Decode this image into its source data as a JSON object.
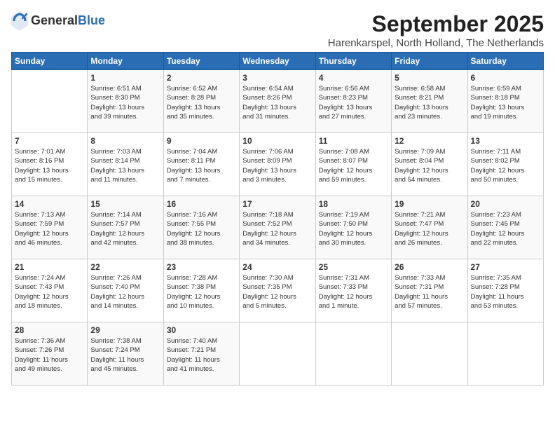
{
  "header": {
    "logo_general": "General",
    "logo_blue": "Blue",
    "month_title": "September 2025",
    "subtitle": "Harenkarspel, North Holland, The Netherlands"
  },
  "days_of_week": [
    "Sunday",
    "Monday",
    "Tuesday",
    "Wednesday",
    "Thursday",
    "Friday",
    "Saturday"
  ],
  "weeks": [
    [
      {
        "day": "",
        "info": ""
      },
      {
        "day": "1",
        "info": "Sunrise: 6:51 AM\nSunset: 8:30 PM\nDaylight: 13 hours\nand 39 minutes."
      },
      {
        "day": "2",
        "info": "Sunrise: 6:52 AM\nSunset: 8:28 PM\nDaylight: 13 hours\nand 35 minutes."
      },
      {
        "day": "3",
        "info": "Sunrise: 6:54 AM\nSunset: 8:26 PM\nDaylight: 13 hours\nand 31 minutes."
      },
      {
        "day": "4",
        "info": "Sunrise: 6:56 AM\nSunset: 8:23 PM\nDaylight: 13 hours\nand 27 minutes."
      },
      {
        "day": "5",
        "info": "Sunrise: 6:58 AM\nSunset: 8:21 PM\nDaylight: 13 hours\nand 23 minutes."
      },
      {
        "day": "6",
        "info": "Sunrise: 6:59 AM\nSunset: 8:18 PM\nDaylight: 13 hours\nand 19 minutes."
      }
    ],
    [
      {
        "day": "7",
        "info": "Sunrise: 7:01 AM\nSunset: 8:16 PM\nDaylight: 13 hours\nand 15 minutes."
      },
      {
        "day": "8",
        "info": "Sunrise: 7:03 AM\nSunset: 8:14 PM\nDaylight: 13 hours\nand 11 minutes."
      },
      {
        "day": "9",
        "info": "Sunrise: 7:04 AM\nSunset: 8:11 PM\nDaylight: 13 hours\nand 7 minutes."
      },
      {
        "day": "10",
        "info": "Sunrise: 7:06 AM\nSunset: 8:09 PM\nDaylight: 13 hours\nand 3 minutes."
      },
      {
        "day": "11",
        "info": "Sunrise: 7:08 AM\nSunset: 8:07 PM\nDaylight: 12 hours\nand 59 minutes."
      },
      {
        "day": "12",
        "info": "Sunrise: 7:09 AM\nSunset: 8:04 PM\nDaylight: 12 hours\nand 54 minutes."
      },
      {
        "day": "13",
        "info": "Sunrise: 7:11 AM\nSunset: 8:02 PM\nDaylight: 12 hours\nand 50 minutes."
      }
    ],
    [
      {
        "day": "14",
        "info": "Sunrise: 7:13 AM\nSunset: 7:59 PM\nDaylight: 12 hours\nand 46 minutes."
      },
      {
        "day": "15",
        "info": "Sunrise: 7:14 AM\nSunset: 7:57 PM\nDaylight: 12 hours\nand 42 minutes."
      },
      {
        "day": "16",
        "info": "Sunrise: 7:16 AM\nSunset: 7:55 PM\nDaylight: 12 hours\nand 38 minutes."
      },
      {
        "day": "17",
        "info": "Sunrise: 7:18 AM\nSunset: 7:52 PM\nDaylight: 12 hours\nand 34 minutes."
      },
      {
        "day": "18",
        "info": "Sunrise: 7:19 AM\nSunset: 7:50 PM\nDaylight: 12 hours\nand 30 minutes."
      },
      {
        "day": "19",
        "info": "Sunrise: 7:21 AM\nSunset: 7:47 PM\nDaylight: 12 hours\nand 26 minutes."
      },
      {
        "day": "20",
        "info": "Sunrise: 7:23 AM\nSunset: 7:45 PM\nDaylight: 12 hours\nand 22 minutes."
      }
    ],
    [
      {
        "day": "21",
        "info": "Sunrise: 7:24 AM\nSunset: 7:43 PM\nDaylight: 12 hours\nand 18 minutes."
      },
      {
        "day": "22",
        "info": "Sunrise: 7:26 AM\nSunset: 7:40 PM\nDaylight: 12 hours\nand 14 minutes."
      },
      {
        "day": "23",
        "info": "Sunrise: 7:28 AM\nSunset: 7:38 PM\nDaylight: 12 hours\nand 10 minutes."
      },
      {
        "day": "24",
        "info": "Sunrise: 7:30 AM\nSunset: 7:35 PM\nDaylight: 12 hours\nand 5 minutes."
      },
      {
        "day": "25",
        "info": "Sunrise: 7:31 AM\nSunset: 7:33 PM\nDaylight: 12 hours\nand 1 minute."
      },
      {
        "day": "26",
        "info": "Sunrise: 7:33 AM\nSunset: 7:31 PM\nDaylight: 11 hours\nand 57 minutes."
      },
      {
        "day": "27",
        "info": "Sunrise: 7:35 AM\nSunset: 7:28 PM\nDaylight: 11 hours\nand 53 minutes."
      }
    ],
    [
      {
        "day": "28",
        "info": "Sunrise: 7:36 AM\nSunset: 7:26 PM\nDaylight: 11 hours\nand 49 minutes."
      },
      {
        "day": "29",
        "info": "Sunrise: 7:38 AM\nSunset: 7:24 PM\nDaylight: 11 hours\nand 45 minutes."
      },
      {
        "day": "30",
        "info": "Sunrise: 7:40 AM\nSunset: 7:21 PM\nDaylight: 11 hours\nand 41 minutes."
      },
      {
        "day": "",
        "info": ""
      },
      {
        "day": "",
        "info": ""
      },
      {
        "day": "",
        "info": ""
      },
      {
        "day": "",
        "info": ""
      }
    ]
  ]
}
